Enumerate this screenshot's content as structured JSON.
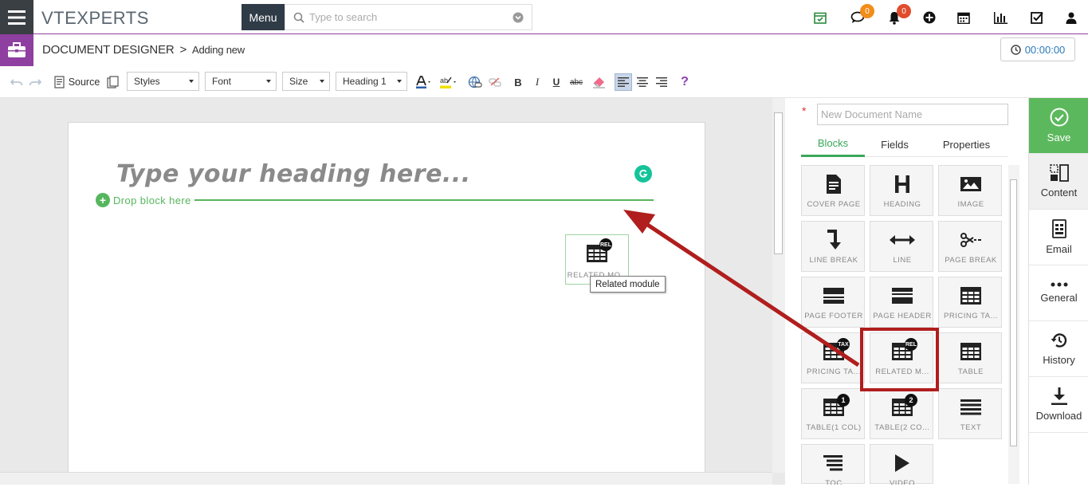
{
  "topbar": {
    "logo_text": "VTEXPERTS",
    "menu_label": "Menu",
    "search_placeholder": "Type to search",
    "chat_badge": "0",
    "notif_badge": "0",
    "chat_badge_color": "#f28c1a",
    "notif_badge_color": "#e04c2c"
  },
  "titlebar": {
    "module": "DOCUMENT DESIGNER",
    "separator": ">",
    "subtitle": "Adding new",
    "timer": "00:00:00"
  },
  "toolbar": {
    "source_label": "Source",
    "styles_label": "Styles",
    "font_label": "Font",
    "size_label": "Size",
    "format_label": "Heading 1"
  },
  "canvas": {
    "heading_placeholder": "Type your heading here...",
    "drop_label": "Drop block here",
    "drag_label": "RELATED MO...",
    "drag_badge": "REL",
    "tooltip": "Related module"
  },
  "panel": {
    "doc_name_placeholder": "New Document Name",
    "required_mark": "*",
    "tabs": [
      {
        "label": "Blocks"
      },
      {
        "label": "Fields"
      },
      {
        "label": "Properties"
      }
    ],
    "blocks": [
      {
        "label": "COVER PAGE",
        "icon": "document-icon"
      },
      {
        "label": "HEADING",
        "icon": "heading-icon"
      },
      {
        "label": "IMAGE",
        "icon": "image-icon"
      },
      {
        "label": "LINE BREAK",
        "icon": "line-break-icon"
      },
      {
        "label": "LINE",
        "icon": "line-icon"
      },
      {
        "label": "PAGE BREAK",
        "icon": "scissors-icon"
      },
      {
        "label": "PAGE FOOTER",
        "icon": "page-footer-icon"
      },
      {
        "label": "PAGE HEADER",
        "icon": "page-header-icon"
      },
      {
        "label": "PRICING TA...",
        "icon": "table-icon"
      },
      {
        "label": "PRICING TA...",
        "icon": "table-icon",
        "badge": "TAX"
      },
      {
        "label": "RELATED M...",
        "icon": "table-icon",
        "badge": "REL"
      },
      {
        "label": "TABLE",
        "icon": "table-icon"
      },
      {
        "label": "TABLE(1 COL)",
        "icon": "table-icon",
        "badge": "1"
      },
      {
        "label": "TABLE(2 CO...",
        "icon": "table-icon",
        "badge": "2"
      },
      {
        "label": "TEXT",
        "icon": "text-icon"
      },
      {
        "label": "TOC",
        "icon": "toc-icon"
      },
      {
        "label": "VIDEO",
        "icon": "play-icon"
      }
    ]
  },
  "sidebar": {
    "save": "Save",
    "content": "Content",
    "email": "Email",
    "general": "General",
    "history": "History",
    "download": "Download"
  },
  "colors": {
    "accent_purple": "#8e3fa0",
    "green": "#5cb85c",
    "annotation_red": "#b01e1e"
  }
}
